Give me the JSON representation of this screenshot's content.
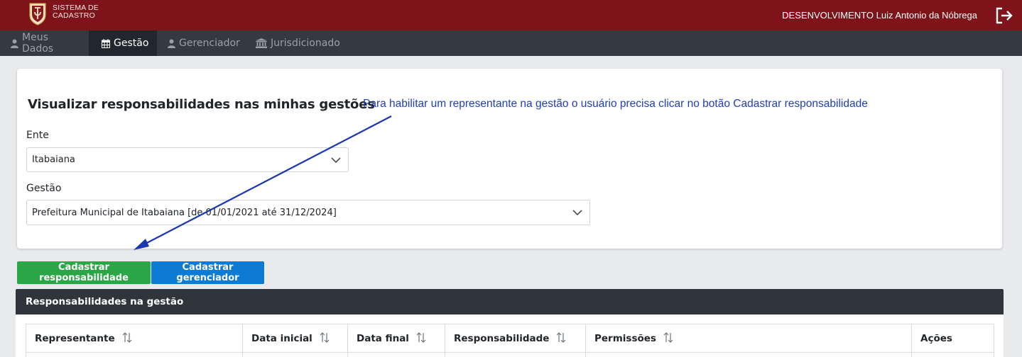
{
  "header": {
    "brand_line1": "SISTEMA DE",
    "brand_line2": "CADASTRO",
    "user_name": "DESENVOLVIMENTO Luiz Antonio da Nóbrega",
    "logout_icon": "sign-out-icon",
    "background_color": "#7e141a"
  },
  "nav": {
    "items": [
      {
        "label": "Meus Dados",
        "icon": "user-icon",
        "active": false
      },
      {
        "label": "Gestão",
        "icon": "calendar-icon",
        "active": true
      },
      {
        "label": "Gerenciador",
        "icon": "user-icon",
        "active": false
      },
      {
        "label": "Jurisdicionado",
        "icon": "institution-icon",
        "active": false
      }
    ]
  },
  "main": {
    "title": "Visualizar responsabilidades nas minhas gestões",
    "annotation": "Para habilitar um representante na gestão o usuário precisa clicar no botão Cadastrar responsabilidade",
    "ente": {
      "label": "Ente",
      "value": "Itabaiana"
    },
    "gestao": {
      "label": "Gestão",
      "value": "Prefeitura Municipal de Itabaiana [de 01/01/2021 até 31/12/2024]"
    }
  },
  "buttons": {
    "cadastrar_responsabilidade": "Cadastrar responsabilidade",
    "cadastrar_gerenciador": "Cadastrar gerenciador",
    "green_color": "#2aa646",
    "blue_color": "#0d7bd4"
  },
  "panel": {
    "title": "Responsabilidades na gestão",
    "columns": [
      "Representante",
      "Data inicial",
      "Data final",
      "Responsabilidade",
      "Permissões",
      "Ações"
    ]
  }
}
